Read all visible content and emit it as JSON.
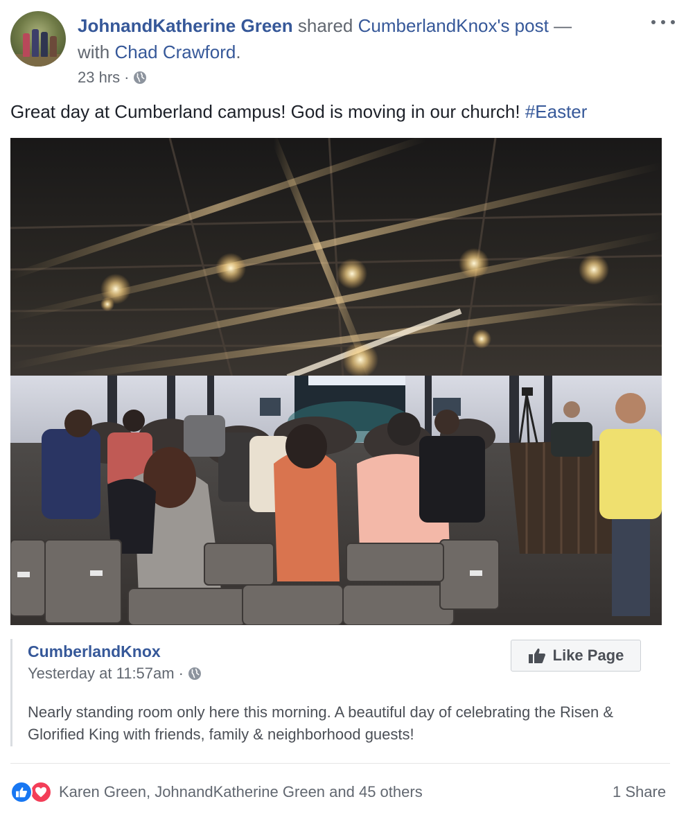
{
  "post": {
    "author": "JohnandKatherine Green",
    "shared_word": "shared",
    "shared_source": "CumberlandKnox's post",
    "dash": "—",
    "with_word": "with",
    "tagged": "Chad Crawford",
    "period": ".",
    "time": "23 hrs",
    "dot": "·",
    "privacy_icon": "globe-icon",
    "status_text": "Great day at Cumberland campus! God is moving in our church!",
    "hashtag": "#Easter"
  },
  "shared_post": {
    "page_name": "CumberlandKnox",
    "time": "Yesterday at 11:57am",
    "dot": "·",
    "privacy_icon": "globe-icon",
    "like_page_label": "Like Page",
    "text": "Nearly standing room only here this morning. A beautiful day of celebrating the Risen & Glorified King with friends, family & neighborhood guests!"
  },
  "footer": {
    "reaction_icons": [
      "like-reaction-icon",
      "love-reaction-icon"
    ],
    "reactions_text": "Karen Green, JohnandKatherine Green and 45 others",
    "shares_text": "1 Share"
  },
  "colors": {
    "link": "#365899",
    "secondary_text": "#616770",
    "like_blue": "#1877f2",
    "love_red": "#f33e58"
  }
}
